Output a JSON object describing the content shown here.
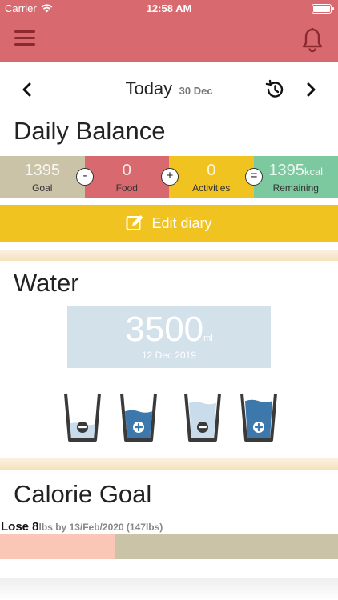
{
  "status_bar": {
    "carrier": "Carrier",
    "time": "12:58 AM"
  },
  "date_nav": {
    "today": "Today",
    "date": "30 Dec"
  },
  "daily_balance": {
    "title": "Daily Balance",
    "goal": {
      "value": "1395",
      "label": "Goal"
    },
    "food": {
      "value": "0",
      "label": "Food"
    },
    "activities": {
      "value": "0",
      "label": "Activities"
    },
    "remaining": {
      "value": "1395",
      "unit": "kcal",
      "label": "Remaining"
    },
    "operators": {
      "minus": "-",
      "plus": "+",
      "equals": "="
    },
    "edit_label": "Edit diary"
  },
  "water": {
    "title": "Water",
    "amount": "3500",
    "unit": "ml",
    "date": "12 Dec 2019",
    "glasses": [
      {
        "icon": "minus-icon",
        "fill": 0.35,
        "dark": false
      },
      {
        "icon": "plus-icon",
        "fill": 0.65,
        "dark": true
      },
      {
        "icon": "minus-icon",
        "fill": 0.85,
        "dark": false
      },
      {
        "icon": "plus-icon",
        "fill": 0.9,
        "dark": true
      }
    ]
  },
  "calorie_goal": {
    "title": "Calorie Goal",
    "lose": "Lose 8",
    "detail": "lbs by 13/Feb/2020 (147lbs)",
    "progress": 0.34
  },
  "colors": {
    "header": "#d86a6f",
    "goal": "#cbc3a7",
    "food": "#d86a6f",
    "activities": "#f1c320",
    "remaining": "#7cc9a0",
    "water_dark": "#3d78ad",
    "water_light": "#c9dcec"
  }
}
